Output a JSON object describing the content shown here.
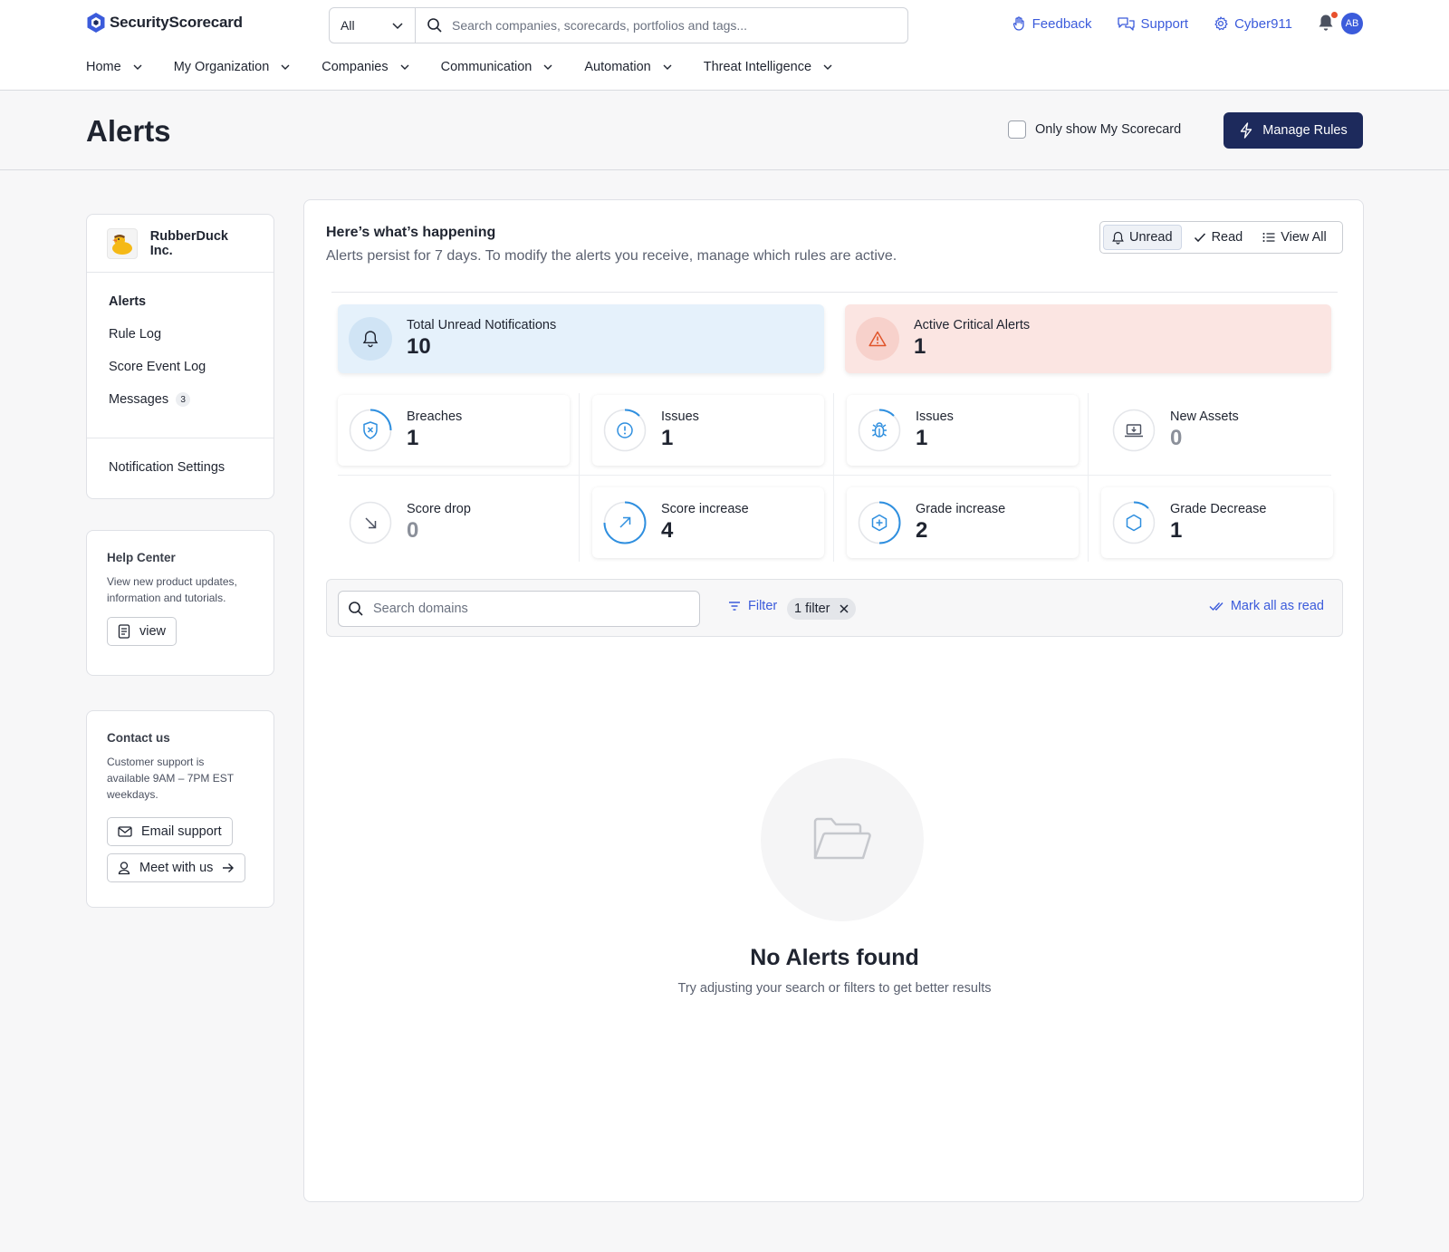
{
  "brand": {
    "name": "SecurityScorecard",
    "accent": "#3b5bdb",
    "navy": "#1d2a5c"
  },
  "header": {
    "scope_select": "All",
    "search_placeholder": "Search companies, scorecards, portfolios and tags...",
    "links": {
      "feedback": "Feedback",
      "support": "Support",
      "cyber911": "Cyber911"
    },
    "avatar_initials": "AB"
  },
  "nav": [
    "Home",
    "My Organization",
    "Companies",
    "Communication",
    "Automation",
    "Threat Intelligence"
  ],
  "page": {
    "title": "Alerts",
    "only_my_label": "Only show My Scorecard",
    "only_my_checked": false,
    "manage_rules": "Manage Rules"
  },
  "sidebar": {
    "org_name": "RubberDuck Inc.",
    "menu": [
      {
        "label": "Alerts",
        "active": true
      },
      {
        "label": "Rule Log"
      },
      {
        "label": "Score Event Log"
      },
      {
        "label": "Messages",
        "badge": "3"
      }
    ],
    "notification_settings": "Notification Settings",
    "help": {
      "title": "Help Center",
      "text": "View new product updates, information and tutorials.",
      "button": "view"
    },
    "contact": {
      "title": "Contact us",
      "text": "Customer support is available 9AM – 7PM EST weekdays.",
      "email_button": "Email support",
      "meet_button": "Meet with us"
    }
  },
  "main": {
    "heading": "Here’s what’s happening",
    "subheading": "Alerts persist for 7 days. To modify the alerts you receive, manage which rules are active.",
    "toggles": {
      "unread": "Unread",
      "read": "Read",
      "all": "View All",
      "selected": "unread"
    },
    "summary": {
      "unread_label": "Total Unread Notifications",
      "unread_value": "10",
      "critical_label": "Active Critical Alerts",
      "critical_value": "1"
    },
    "stats": [
      {
        "label": "Breaches",
        "value": "1",
        "icon": "shield-x-icon"
      },
      {
        "label": "Issues",
        "value": "1",
        "icon": "alert-circle-icon"
      },
      {
        "label": "Issues",
        "value": "1",
        "icon": "bug-icon"
      },
      {
        "label": "New Assets",
        "value": "0",
        "icon": "laptop-download-icon"
      },
      {
        "label": "Score drop",
        "value": "0",
        "icon": "arrow-down-right-icon"
      },
      {
        "label": "Score increase",
        "value": "4",
        "icon": "arrow-up-right-icon"
      },
      {
        "label": "Grade increase",
        "value": "2",
        "icon": "hexagon-plus-icon"
      },
      {
        "label": "Grade Decrease",
        "value": "1",
        "icon": "hexagon-icon"
      }
    ],
    "filter_bar": {
      "search_placeholder": "Search domains",
      "filter_label": "Filter",
      "chip_label": "1 filter",
      "mark_all_read": "Mark all as read"
    },
    "empty": {
      "title": "No Alerts found",
      "subtitle": "Try adjusting your search or filters to get better results"
    }
  }
}
